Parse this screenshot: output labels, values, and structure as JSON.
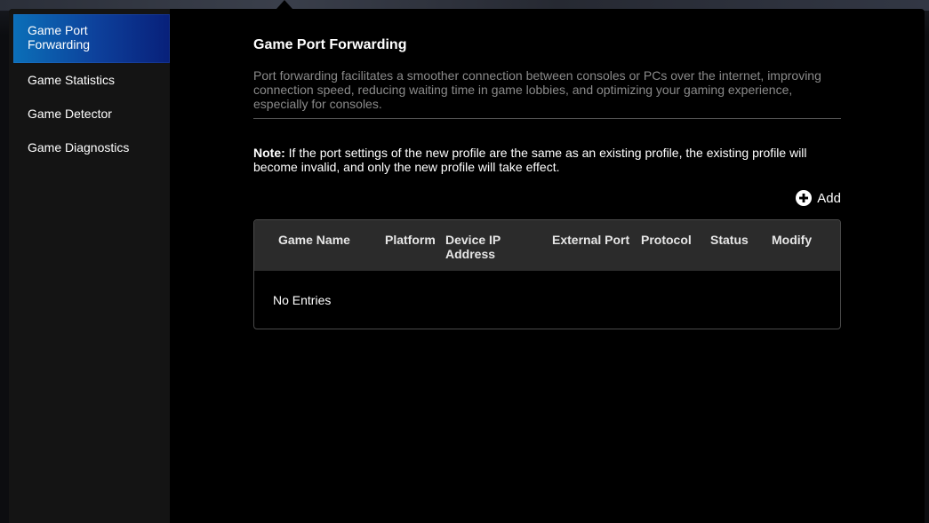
{
  "sidebar": {
    "items": [
      {
        "label": "Game Port Forwarding",
        "line1": "Game Port",
        "line2": "Forwarding",
        "active": true
      },
      {
        "label": "Game Statistics",
        "active": false
      },
      {
        "label": "Game Detector",
        "active": false
      },
      {
        "label": "Game Diagnostics",
        "active": false
      }
    ]
  },
  "main": {
    "title": "Game Port Forwarding",
    "description": "Port forwarding facilitates a smoother connection between consoles or PCs over the internet, improving connection speed, reducing waiting time in game lobbies, and optimizing your gaming experience, especially for consoles.",
    "note_label": "Note:",
    "note_text": " If the port settings of the new profile are the same as an existing profile, the existing profile will become invalid, and only the new profile will take effect.",
    "add_label": "Add",
    "table": {
      "columns": [
        "Game Name",
        "Platform",
        "Device IP Address",
        "External Port",
        "Protocol",
        "Status",
        "Modify"
      ],
      "empty_text": "No Entries"
    }
  },
  "colors": {
    "active_gradient_start": "#0b6fb8",
    "active_gradient_end": "#08207a",
    "panel_bg": "#000000",
    "sidebar_bg": "#141414",
    "table_header_bg": "#2b2b2b"
  },
  "icons": {
    "add": "plus-circle-icon"
  }
}
